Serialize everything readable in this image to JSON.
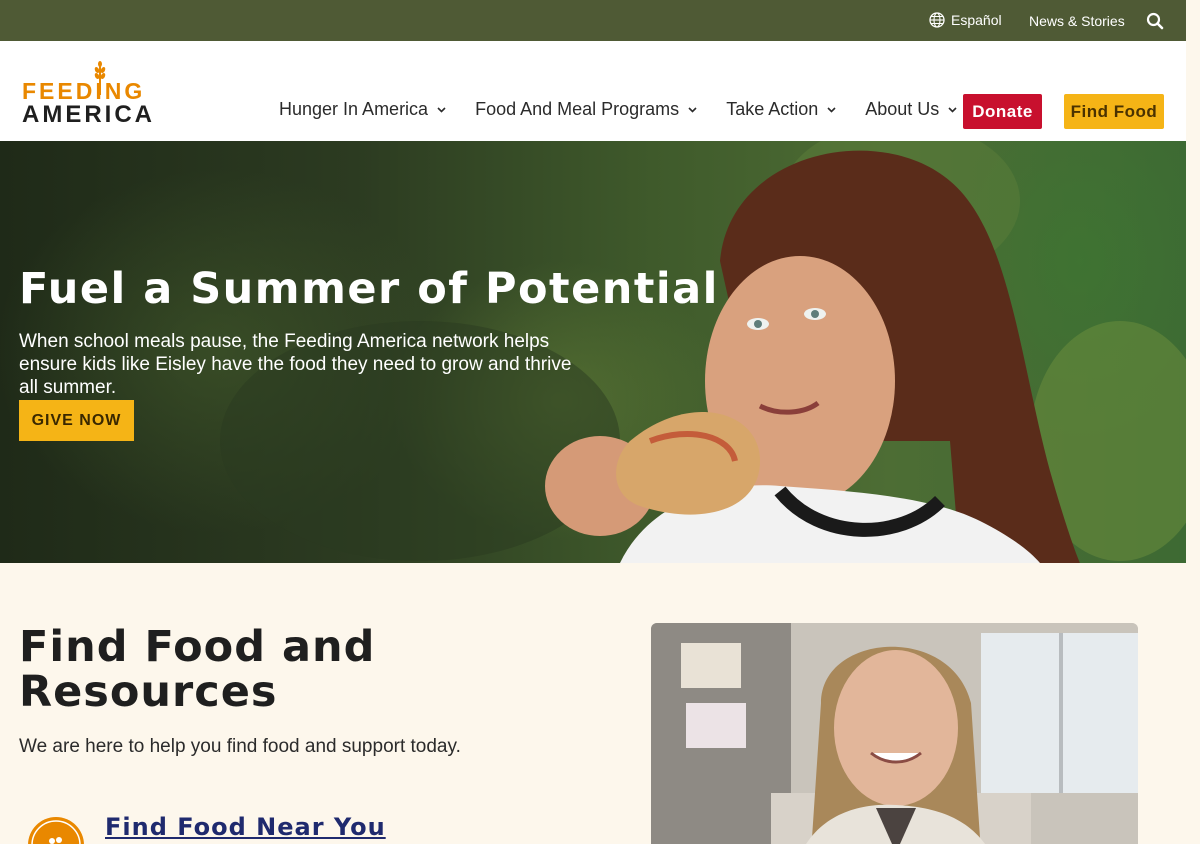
{
  "utility": {
    "language_label": "Español",
    "news_label": "News & Stories",
    "icons": {
      "language": "globe-icon",
      "search": "search-icon"
    }
  },
  "logo": {
    "line1": "FEEDING",
    "line2": "AMERICA"
  },
  "nav": {
    "items": [
      {
        "label": "Hunger In America"
      },
      {
        "label": "Food And Meal Programs"
      },
      {
        "label": "Take Action"
      },
      {
        "label": "About Us"
      }
    ]
  },
  "header_buttons": {
    "donate": "Donate",
    "find_food": "Find Food"
  },
  "hero": {
    "title": "Fuel a Summer of Potential",
    "description": "When school meals pause, the Feeding America network helps ensure kids like Eisley have the food they need to grow and thrive all summer.",
    "cta": "GIVE NOW"
  },
  "find_food_section": {
    "title": "Find Food and Resources",
    "subtitle": "We are here to help you find food and support today.",
    "link_label": "Find Food Near You"
  },
  "colors": {
    "utility_bar": "#4f5a35",
    "donate": "#c8102e",
    "find_food": "#f5b416",
    "brand_orange": "#e98800",
    "section_bg": "#fdf7ec",
    "link": "#1f2a6e"
  }
}
